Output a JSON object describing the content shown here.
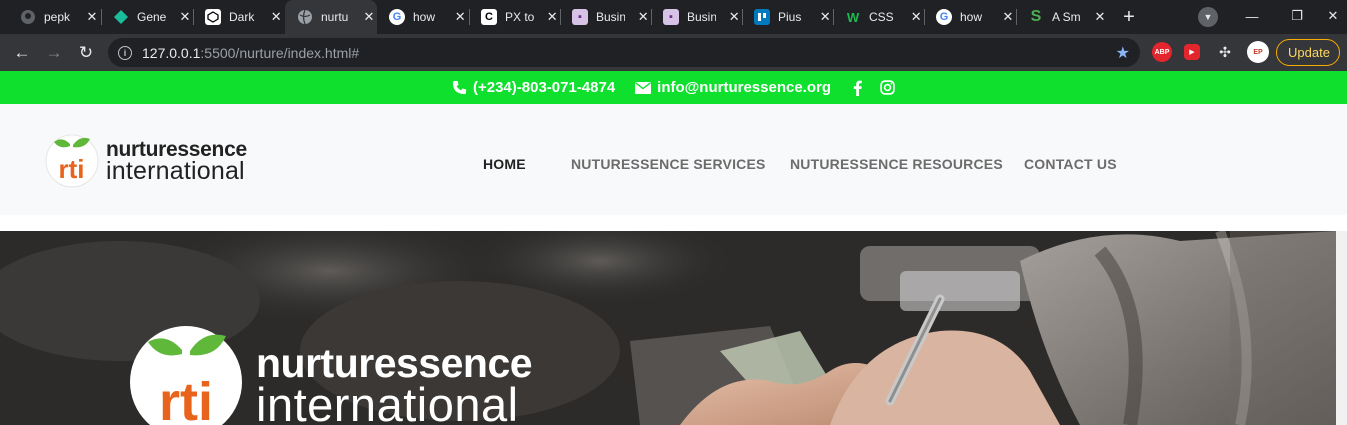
{
  "browser": {
    "tabs": [
      {
        "title": "pepk",
        "icon": "github-icon",
        "active": false
      },
      {
        "title": "Gene",
        "icon": "diamond-icon",
        "active": false
      },
      {
        "title": "Dark",
        "icon": "codepen-icon",
        "active": false
      },
      {
        "title": "nurtu",
        "icon": "globe-icon",
        "active": true
      },
      {
        "title": "how",
        "icon": "google-icon",
        "active": false
      },
      {
        "title": "PX to",
        "icon": "c-logo-icon",
        "active": false
      },
      {
        "title": "Busin",
        "icon": "business-icon",
        "active": false
      },
      {
        "title": "Busin",
        "icon": "business-icon",
        "active": false
      },
      {
        "title": "Pius",
        "icon": "trello-icon",
        "active": false
      },
      {
        "title": "CSS",
        "icon": "w-logo-icon",
        "active": false
      },
      {
        "title": "how",
        "icon": "google-icon",
        "active": false
      },
      {
        "title": "A Sm",
        "icon": "s-logo-icon",
        "active": false
      }
    ],
    "url_host": "127.0.0.1",
    "url_rest": ":5500/nurture/index.html#",
    "update_label": "Update",
    "ext_abp": "ABP",
    "ext_profile": "EP"
  },
  "topbar": {
    "phone": "(+234)-803-071-4874",
    "email": "info@nurturessence.org",
    "bg_color": "#0fe02e"
  },
  "logo": {
    "monogram": "rti",
    "line1": "nurturessence",
    "line2": "international"
  },
  "nav": {
    "items": [
      {
        "label": "HOME",
        "current": true
      },
      {
        "label": "NUTURESSENCE SERVICES",
        "current": false
      },
      {
        "label": "NUTURESSENCE RESOURCES",
        "current": false
      },
      {
        "label": "CONTACT US",
        "current": false
      }
    ]
  }
}
